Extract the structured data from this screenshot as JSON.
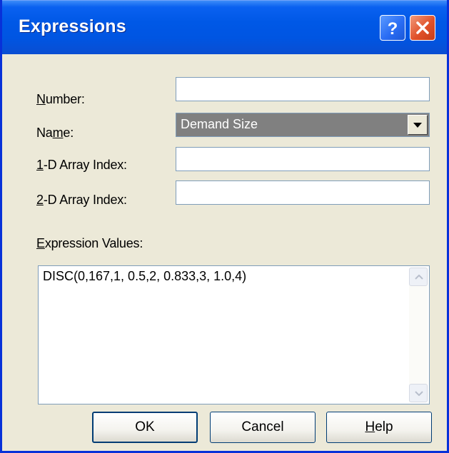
{
  "window": {
    "title": "Expressions",
    "title_buttons": {
      "help_icon": "question-icon",
      "close_icon": "close-x-icon"
    }
  },
  "form": {
    "number": {
      "label_key": "N",
      "label_rest": "umber:",
      "value": ""
    },
    "name": {
      "label_pre": "Na",
      "label_key": "m",
      "label_post": "e:",
      "value": "Demand Size"
    },
    "array1": {
      "label_key": "1",
      "label_rest": "-D Array Index:",
      "value": ""
    },
    "array2": {
      "label_key": "2",
      "label_rest": "-D Array Index:",
      "value": ""
    },
    "expression_values": {
      "label_key": "E",
      "label_rest": "xpression Values:",
      "value": "DISC(0,167,1, 0.5,2, 0.833,3, 1.0,4)"
    }
  },
  "buttons": {
    "ok": "OK",
    "cancel": "Cancel",
    "help_key": "H",
    "help_rest": "elp"
  },
  "colors": {
    "titlebar": "#0058e6",
    "dialog_bg": "#ece9d8",
    "close_button": "#e0512a",
    "selected_combo_bg": "#808080"
  }
}
